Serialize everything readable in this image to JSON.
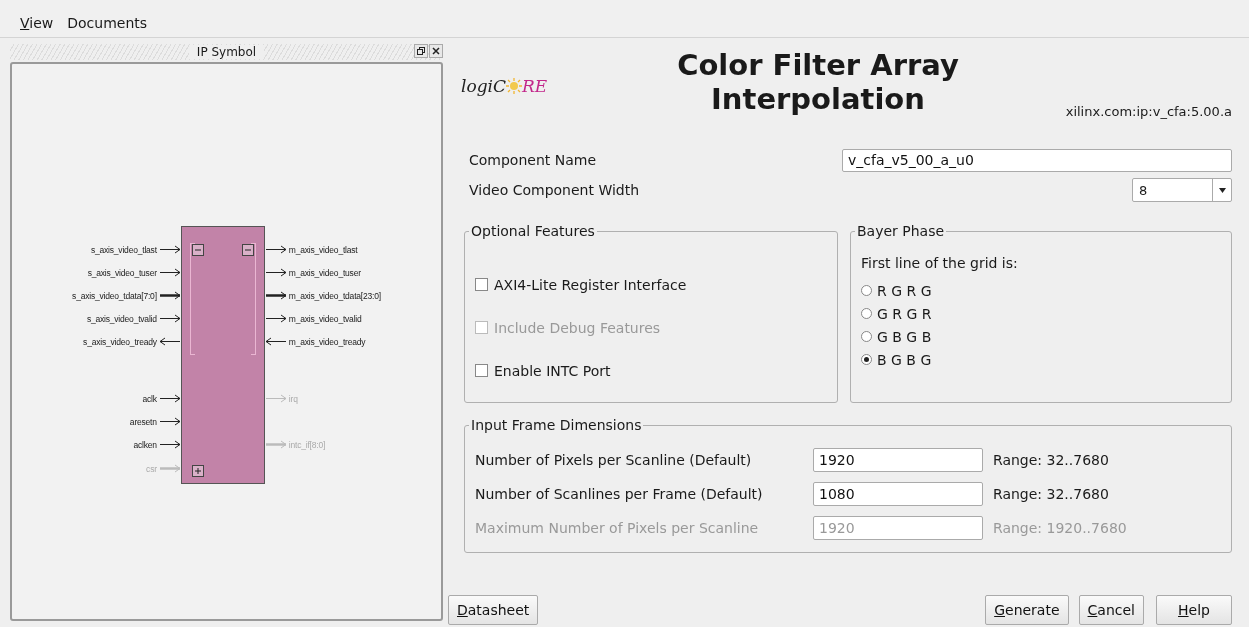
{
  "menu": [
    {
      "label": "View",
      "mnemonic": true
    },
    {
      "label": "Documents",
      "mnemonic": false
    }
  ],
  "ip_symbol_panel": {
    "title": "IP Symbol",
    "left_groups": [
      {
        "expanded": true,
        "pins": [
          {
            "label": "s_axis_video_tlast",
            "kind": "in",
            "disabled": false
          },
          {
            "label": "s_axis_video_tuser",
            "kind": "in",
            "disabled": false
          },
          {
            "label": "s_axis_video_tdata[7:0]",
            "kind": "bus_in",
            "disabled": false
          },
          {
            "label": "s_axis_video_tvalid",
            "kind": "in",
            "disabled": false
          },
          {
            "label": "s_axis_video_tready",
            "kind": "out",
            "disabled": false
          }
        ]
      },
      {
        "pins": [
          {
            "label": "aclk",
            "kind": "in",
            "disabled": false
          },
          {
            "label": "aresetn",
            "kind": "in",
            "disabled": false
          },
          {
            "label": "aclken",
            "kind": "in",
            "disabled": false
          }
        ]
      },
      {
        "expanded": false,
        "pins": [
          {
            "label": "csr",
            "kind": "bus_in",
            "disabled": true
          }
        ]
      }
    ],
    "right_groups": [
      {
        "expanded": true,
        "pins": [
          {
            "label": "m_axis_video_tlast",
            "kind": "out",
            "disabled": false
          },
          {
            "label": "m_axis_video_tuser",
            "kind": "out",
            "disabled": false
          },
          {
            "label": "m_axis_video_tdata[23:0]",
            "kind": "bus_out",
            "disabled": false
          },
          {
            "label": "m_axis_video_tvalid",
            "kind": "out",
            "disabled": false
          },
          {
            "label": "m_axis_video_tready",
            "kind": "in",
            "disabled": false
          }
        ]
      },
      {
        "pins": [
          {
            "label": "irq",
            "kind": "out",
            "disabled": true
          },
          {
            "label": "intc_if[8:0]",
            "kind": "bus_out",
            "disabled": true
          }
        ]
      }
    ]
  },
  "header": {
    "logo": {
      "lead": "logiC",
      "tail": "RE"
    },
    "title": "Color Filter Array",
    "subtitle": "Interpolation",
    "ip_id": "xilinx.com:ip:v_cfa:5.00.a"
  },
  "component_name": {
    "label": "Component Name",
    "value": "v_cfa_v5_00_a_u0"
  },
  "video_component_width": {
    "label": "Video Component Width",
    "value": "8"
  },
  "optional_features": {
    "title": "Optional Features",
    "options": [
      {
        "label": "AXI4-Lite Register Interface",
        "checked": false,
        "disabled": false
      },
      {
        "label": "Include Debug Features",
        "checked": false,
        "disabled": true
      },
      {
        "label": "Enable INTC Port",
        "checked": false,
        "disabled": false
      }
    ]
  },
  "bayer_phase": {
    "title": "Bayer Phase",
    "prompt": "First line of the grid is:",
    "options": [
      {
        "label": "R G R G",
        "selected": false
      },
      {
        "label": "G R G R",
        "selected": false
      },
      {
        "label": "G B G B",
        "selected": false
      },
      {
        "label": "B G B G",
        "selected": true
      }
    ]
  },
  "input_frame_dimensions": {
    "title": "Input Frame Dimensions",
    "rows": [
      {
        "label": "Number of Pixels per Scanline (Default)",
        "value": "1920",
        "range": "Range: 32..7680",
        "disabled": false
      },
      {
        "label": "Number of Scanlines per Frame (Default)",
        "value": "1080",
        "range": "Range: 32..7680",
        "disabled": false
      },
      {
        "label": "Maximum Number of Pixels per Scanline",
        "value": "1920",
        "range": "Range: 1920..7680",
        "disabled": true
      }
    ]
  },
  "buttons": [
    {
      "label": "Datasheet",
      "mnemonic": true
    },
    {
      "label": "Generate",
      "mnemonic": true
    },
    {
      "label": "Cancel",
      "mnemonic": true
    },
    {
      "label": "Help",
      "mnemonic": true
    }
  ]
}
